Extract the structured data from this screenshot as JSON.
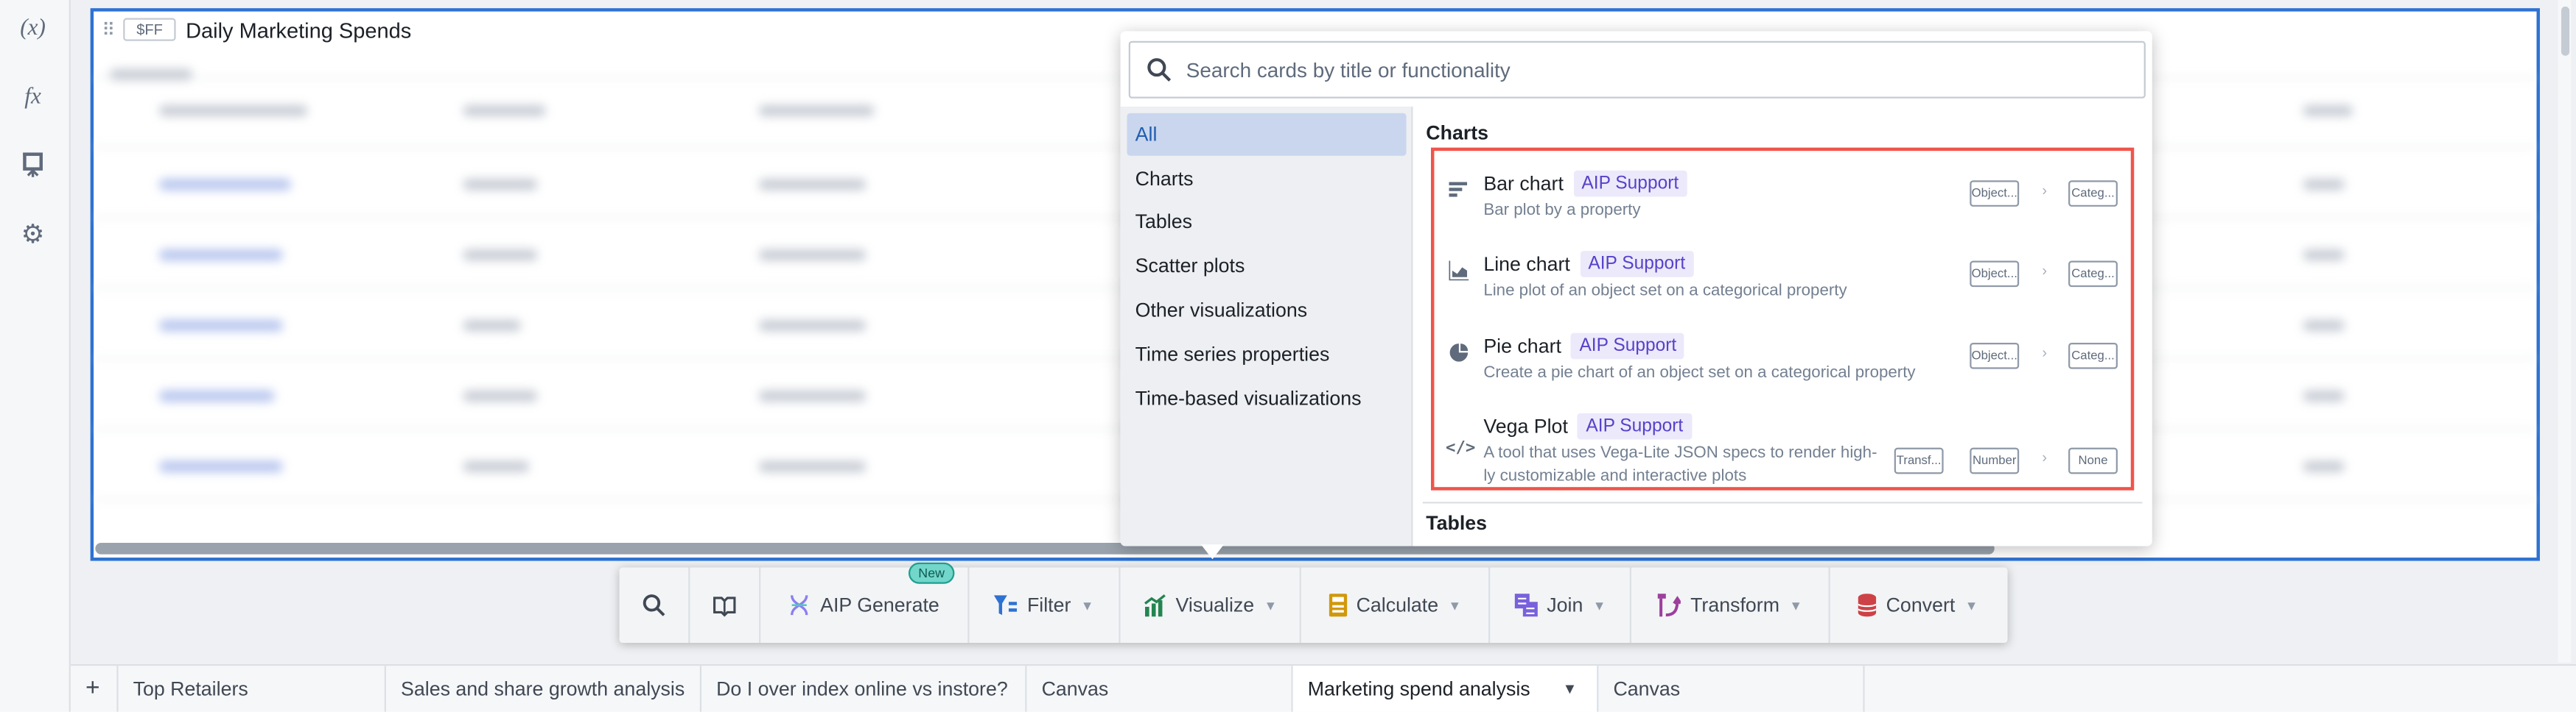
{
  "left_sidebar": {
    "items": [
      {
        "icon": "variable-icon",
        "label": "(x)"
      },
      {
        "icon": "function-icon",
        "label": "fx"
      },
      {
        "icon": "presentation-icon"
      },
      {
        "icon": "gear-icon"
      }
    ]
  },
  "card": {
    "badge": "$FF",
    "title": "Daily Marketing Spends"
  },
  "picker": {
    "search_placeholder": "Search cards by title or functionality",
    "categories": [
      "All",
      "Charts",
      "Tables",
      "Scatter plots",
      "Other visualizations",
      "Time series properties",
      "Time-based visualizations"
    ],
    "selected_category": "All",
    "section_charts": "Charts",
    "section_tables": "Tables",
    "items": [
      {
        "icon": "bar-chart-icon",
        "title": "Bar chart",
        "badge": "AIP Support",
        "desc": "Bar plot by a property",
        "chips": [
          "Object...",
          "Categ..."
        ]
      },
      {
        "icon": "line-chart-icon",
        "title": "Line chart",
        "badge": "AIP Support",
        "desc": "Line plot of an object set on a categorical property",
        "chips": [
          "Object...",
          "Categ..."
        ]
      },
      {
        "icon": "pie-chart-icon",
        "title": "Pie chart",
        "badge": "AIP Support",
        "desc": "Create a pie chart of an object set on a categorical property",
        "chips": [
          "Object...",
          "Categ..."
        ]
      },
      {
        "icon": "code-icon",
        "title": "Vega Plot",
        "badge": "AIP Support",
        "desc": "A tool that uses Vega-Lite JSON specs to render high-ly customizable and interactive plots",
        "chips": [
          "Transf...",
          "Number",
          "None"
        ]
      }
    ],
    "highlight_color": "#f0544a"
  },
  "toolbar": {
    "new_badge": "New",
    "buttons": [
      {
        "icon": "search-icon"
      },
      {
        "icon": "book-icon"
      },
      {
        "icon": "aip-icon",
        "label": "AIP Generate"
      },
      {
        "icon": "filter-icon",
        "label": "Filter"
      },
      {
        "icon": "visualize-icon",
        "label": "Visualize"
      },
      {
        "icon": "calculator-icon",
        "label": "Calculate"
      },
      {
        "icon": "join-icon",
        "label": "Join"
      },
      {
        "icon": "transform-icon",
        "label": "Transform"
      },
      {
        "icon": "database-icon",
        "label": "Convert"
      }
    ]
  },
  "tabs": {
    "add": "+",
    "items": [
      "Top Retailers",
      "Sales and share growth analysis",
      "Do I over index online vs instore?",
      "Canvas",
      "Marketing spend analysis",
      "Canvas"
    ],
    "active": "Marketing spend analysis"
  }
}
